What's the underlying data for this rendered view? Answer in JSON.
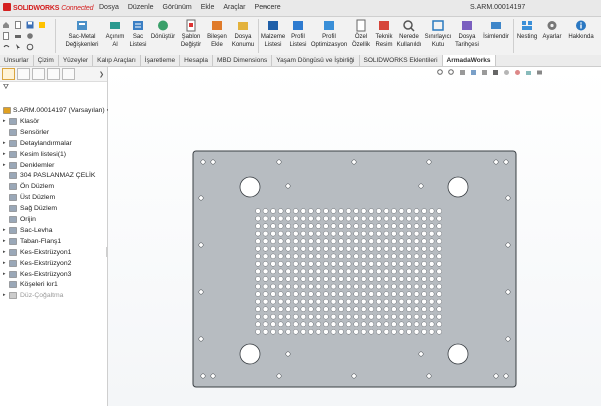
{
  "app": {
    "brand": "SOLIDWORKS",
    "brand_suffix": "Connected",
    "title": "S.ARM.00014197"
  },
  "menu": [
    "Dosya",
    "Düzenle",
    "Görünüm",
    "Ekle",
    "Araçlar",
    "Pencere"
  ],
  "ribbon": [
    {
      "label": "Sac-Metal Değişkenleri",
      "icon": "sheet-metal-params-icon"
    },
    {
      "label": "Açınım Al",
      "icon": "flatten-icon"
    },
    {
      "label": "Sac Listesi",
      "icon": "sheet-list-icon"
    },
    {
      "label": "Dönüştür",
      "icon": "convert-icon"
    },
    {
      "label": "Şablon Değiştir",
      "icon": "template-icon"
    },
    {
      "label": "Bileşen Ekle",
      "icon": "add-component-icon"
    },
    {
      "label": "Dosya Konumu",
      "icon": "file-location-icon"
    },
    {
      "label": "Malzeme Listesi",
      "icon": "material-list-icon"
    },
    {
      "label": "Profil Listesi",
      "icon": "profile-list-icon"
    },
    {
      "label": "Profil Optimizasyon",
      "icon": "profile-optimization-icon"
    },
    {
      "label": "Özel Özellik",
      "icon": "custom-property-icon"
    },
    {
      "label": "Teknik Resim",
      "icon": "drawing-icon"
    },
    {
      "label": "Nerede Kullanıldı",
      "icon": "where-used-icon"
    },
    {
      "label": "Sınırlayıcı Kutu",
      "icon": "bounding-box-icon"
    },
    {
      "label": "Dosya Tarihçesi",
      "icon": "file-history-icon"
    },
    {
      "label": "İsimlendir",
      "icon": "rename-icon"
    },
    {
      "label": "Nesting",
      "icon": "nesting-icon"
    },
    {
      "label": "Ayarlar",
      "icon": "settings-icon"
    },
    {
      "label": "Hakkında",
      "icon": "about-icon"
    }
  ],
  "tabs": [
    {
      "label": "Unsurlar"
    },
    {
      "label": "Çizim"
    },
    {
      "label": "Yüzeyler"
    },
    {
      "label": "Kalıp Araçları"
    },
    {
      "label": "İşaretleme"
    },
    {
      "label": "Hesapla"
    },
    {
      "label": "MBD Dimensions"
    },
    {
      "label": "Yaşam Döngüsü ve İşbirliği"
    },
    {
      "label": "SOLIDWORKS Eklentileri"
    },
    {
      "label": "ArmadaWorks"
    }
  ],
  "active_tab": "ArmadaWorks",
  "tree": [
    {
      "label": "S.ARM.00014197  (Varsayılan) <<Varsa...",
      "level": 0,
      "expand": "",
      "icon": "part-icon"
    },
    {
      "label": "Klasör",
      "level": 1,
      "expand": "▸",
      "icon": "folder-icon"
    },
    {
      "label": "Sensörler",
      "level": 1,
      "expand": "",
      "icon": "sensor-icon"
    },
    {
      "label": "Detaylandırmalar",
      "level": 1,
      "expand": "▸",
      "icon": "annotation-icon"
    },
    {
      "label": "Kesim listesi(1)",
      "level": 1,
      "expand": "▸",
      "icon": "cut-list-icon"
    },
    {
      "label": "Denklemler",
      "level": 1,
      "expand": "▸",
      "icon": "equation-icon"
    },
    {
      "label": "304 PASLANMAZ ÇELİK",
      "level": 1,
      "expand": "",
      "icon": "material-icon"
    },
    {
      "label": "Ön Düzlem",
      "level": 1,
      "expand": "",
      "icon": "plane-icon"
    },
    {
      "label": "Üst Düzlem",
      "level": 1,
      "expand": "",
      "icon": "plane-icon"
    },
    {
      "label": "Sağ Düzlem",
      "level": 1,
      "expand": "",
      "icon": "plane-icon"
    },
    {
      "label": "Orijin",
      "level": 1,
      "expand": "",
      "icon": "origin-icon"
    },
    {
      "label": "Sac-Levha",
      "level": 1,
      "expand": "▸",
      "icon": "sheet-metal-icon"
    },
    {
      "label": "Taban-Flanş1",
      "level": 1,
      "expand": "▸",
      "icon": "base-flange-icon"
    },
    {
      "label": "Kes-Ekstrüzyon1",
      "level": 1,
      "expand": "▸",
      "icon": "cut-extrude-icon"
    },
    {
      "label": "Kes-Ekstrüzyon2",
      "level": 1,
      "expand": "▸",
      "icon": "cut-extrude-icon"
    },
    {
      "label": "Kes-Ekstrüzyon3",
      "level": 1,
      "expand": "▸",
      "icon": "cut-extrude-icon"
    },
    {
      "label": "Köşeleri kır1",
      "level": 1,
      "expand": "",
      "icon": "break-corner-icon"
    },
    {
      "label": "Düz-Çoğaltma",
      "level": 1,
      "expand": "▸",
      "icon": "flat-pattern-icon",
      "dim": true
    }
  ]
}
